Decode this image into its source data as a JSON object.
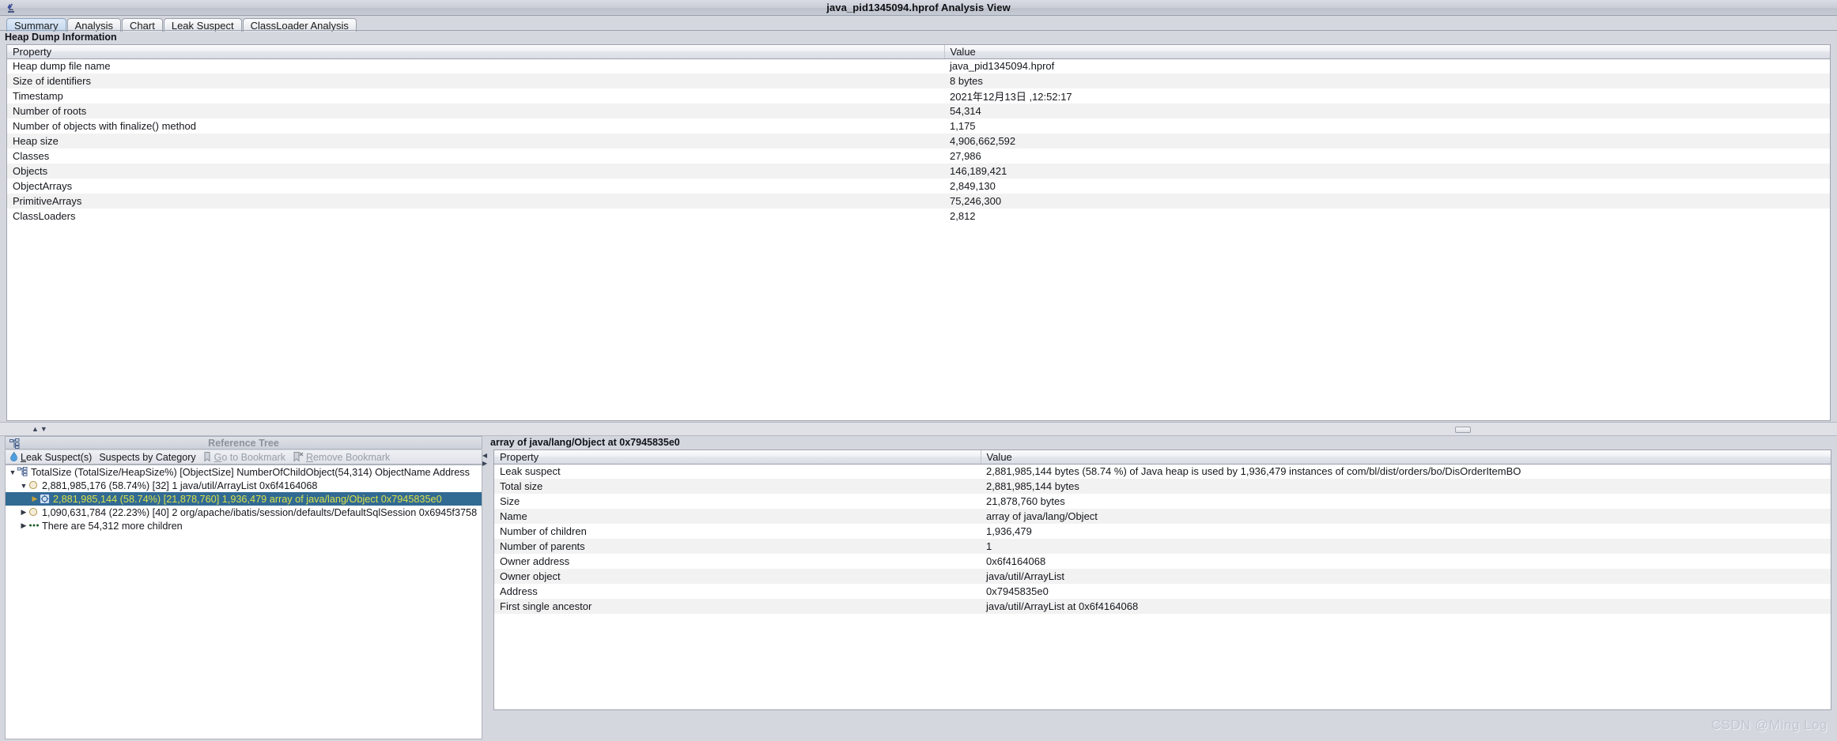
{
  "window": {
    "title": "java_pid1345094.hprof Analysis View",
    "app_icon": "microscope-icon"
  },
  "tabs": [
    {
      "label": "Summary",
      "selected": true
    },
    {
      "label": "Analysis",
      "selected": false
    },
    {
      "label": "Chart",
      "selected": false
    },
    {
      "label": "Leak Suspect",
      "selected": false
    },
    {
      "label": "ClassLoader Analysis",
      "selected": false
    }
  ],
  "summary": {
    "band_title": "Heap Dump Information",
    "columns": [
      "Property",
      "Value"
    ],
    "rows": [
      {
        "property": "Heap dump file name",
        "value": "java_pid1345094.hprof"
      },
      {
        "property": "Size of identifiers",
        "value": "8 bytes"
      },
      {
        "property": "Timestamp",
        "value": "2021年12月13日 ,12:52:17"
      },
      {
        "property": "Number of roots",
        "value": "54,314"
      },
      {
        "property": "Number of objects with finalize() method",
        "value": "1,175"
      },
      {
        "property": "Heap size",
        "value": "4,906,662,592"
      },
      {
        "property": "Classes",
        "value": "27,986"
      },
      {
        "property": "Objects",
        "value": "146,189,421"
      },
      {
        "property": "ObjectArrays",
        "value": "2,849,130"
      },
      {
        "property": "PrimitiveArrays",
        "value": "75,246,300"
      },
      {
        "property": "ClassLoaders",
        "value": "2,812"
      }
    ]
  },
  "reference_tree": {
    "panel_title": "Reference Tree",
    "panel_icon": "tree-icon",
    "toolbar": [
      {
        "label": "Leak Suspect(s)",
        "icon": "flame-icon",
        "underline_first": true,
        "disabled": false
      },
      {
        "label": "Suspects by Category",
        "icon": "",
        "disabled": false
      },
      {
        "label": "Go to Bookmark",
        "icon": "bookmark-icon",
        "disabled": true
      },
      {
        "label": "Remove Bookmark",
        "icon": "bookmark-remove-icon",
        "disabled": true
      }
    ],
    "nodes": [
      {
        "depth": 0,
        "twisty": "▼",
        "icon": "tree-icon",
        "label": "TotalSize (TotalSize/HeapSize%) [ObjectSize] NumberOfChildObject(54,314) ObjectName Address",
        "selected": false
      },
      {
        "depth": 1,
        "twisty": "▼",
        "icon": "circle-icon",
        "label": "2,881,985,176 (58.74%) [32] 1 java/util/ArrayList 0x6f4164068",
        "selected": false
      },
      {
        "depth": 2,
        "twisty": "▶",
        "icon": "array-icon",
        "label": "2,881,985,144 (58.74%) [21,878,760] 1,936,479 array of java/lang/Object 0x7945835e0",
        "selected": true
      },
      {
        "depth": 1,
        "twisty": "▶",
        "icon": "circle-icon",
        "label": "1,090,631,784 (22.23%) [40] 2 org/apache/ibatis/session/defaults/DefaultSqlSession 0x6945f3758",
        "selected": false
      },
      {
        "depth": 1,
        "twisty": "▶",
        "icon": "ellipsis-icon",
        "label": "There are 54,312 more children",
        "selected": false
      }
    ]
  },
  "detail": {
    "band_title": "array of java/lang/Object at 0x7945835e0",
    "columns": [
      "Property",
      "Value"
    ],
    "rows": [
      {
        "property": "Leak suspect",
        "value": "2,881,985,144 bytes (58.74 %) of Java heap is used by 1,936,479 instances of com/bl/dist/orders/bo/DisOrderItemBO"
      },
      {
        "property": "Total size",
        "value": "2,881,985,144 bytes"
      },
      {
        "property": "Size",
        "value": "21,878,760 bytes"
      },
      {
        "property": "Name",
        "value": "array of java/lang/Object"
      },
      {
        "property": "Number of children",
        "value": "1,936,479"
      },
      {
        "property": "Number of parents",
        "value": "1"
      },
      {
        "property": "Owner address",
        "value": "0x6f4164068"
      },
      {
        "property": "Owner object",
        "value": "java/util/ArrayList"
      },
      {
        "property": "Address",
        "value": "0x7945835e0"
      },
      {
        "property": "First single ancestor",
        "value": "java/util/ArrayList at 0x6f4164068"
      }
    ]
  },
  "watermark": "CSDN @Ming Log",
  "colors": {
    "selection_bg": "#316a93",
    "selection_fg": "#d8e04a",
    "panel_bg": "#d4d7de",
    "row_alt": "#f2f2f2"
  }
}
